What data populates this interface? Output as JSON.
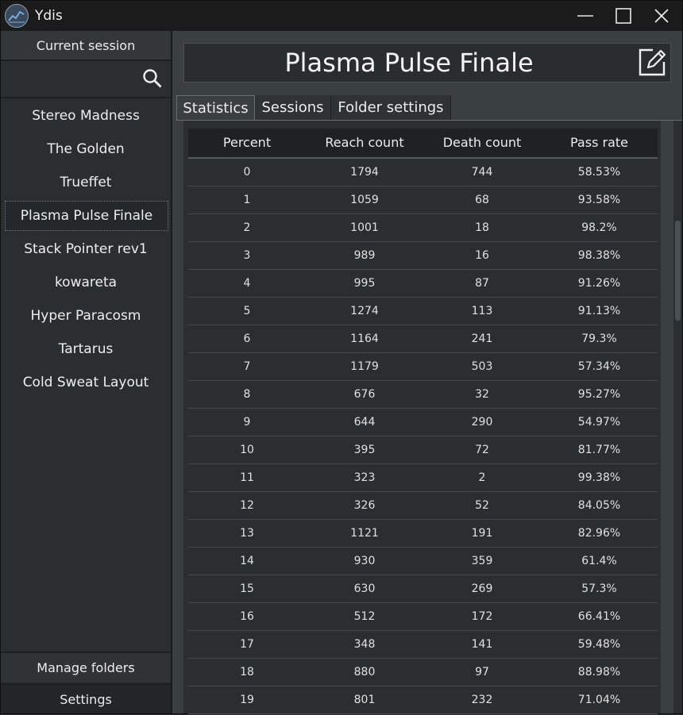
{
  "app": {
    "title": "Ydis"
  },
  "sidebar": {
    "header": "Current session",
    "search": {
      "value": "",
      "placeholder": ""
    },
    "levels": [
      "Stereo Madness",
      "The Golden",
      "Trueffet",
      "Plasma Pulse Finale",
      "Stack Pointer rev1",
      "kowareta",
      "Hyper Paracosm",
      "Tartarus",
      "Cold Sweat Layout"
    ],
    "selected_index": 3,
    "manage_folders": "Manage folders",
    "settings": "Settings"
  },
  "main": {
    "level_title": "Plasma Pulse Finale",
    "tabs": [
      "Statistics",
      "Sessions",
      "Folder settings"
    ],
    "active_tab": 0,
    "table": {
      "headers": [
        "Percent",
        "Reach count",
        "Death count",
        "Pass rate"
      ],
      "rows": [
        [
          "0",
          "1794",
          "744",
          "58.53%"
        ],
        [
          "1",
          "1059",
          "68",
          "93.58%"
        ],
        [
          "2",
          "1001",
          "18",
          "98.2%"
        ],
        [
          "3",
          "989",
          "16",
          "98.38%"
        ],
        [
          "4",
          "995",
          "87",
          "91.26%"
        ],
        [
          "5",
          "1274",
          "113",
          "91.13%"
        ],
        [
          "6",
          "1164",
          "241",
          "79.3%"
        ],
        [
          "7",
          "1179",
          "503",
          "57.34%"
        ],
        [
          "8",
          "676",
          "32",
          "95.27%"
        ],
        [
          "9",
          "644",
          "290",
          "54.97%"
        ],
        [
          "10",
          "395",
          "72",
          "81.77%"
        ],
        [
          "11",
          "323",
          "2",
          "99.38%"
        ],
        [
          "12",
          "326",
          "52",
          "84.05%"
        ],
        [
          "13",
          "1121",
          "191",
          "82.96%"
        ],
        [
          "14",
          "930",
          "359",
          "61.4%"
        ],
        [
          "15",
          "630",
          "269",
          "57.3%"
        ],
        [
          "16",
          "512",
          "172",
          "66.41%"
        ],
        [
          "17",
          "348",
          "141",
          "59.48%"
        ],
        [
          "18",
          "880",
          "97",
          "88.98%"
        ],
        [
          "19",
          "801",
          "232",
          "71.04%"
        ]
      ]
    }
  },
  "icons": {
    "app": "chart-line-icon",
    "search": "search-icon",
    "edit": "edit-icon",
    "minimize": "minimize-icon",
    "maximize": "maximize-icon",
    "close": "close-icon"
  }
}
